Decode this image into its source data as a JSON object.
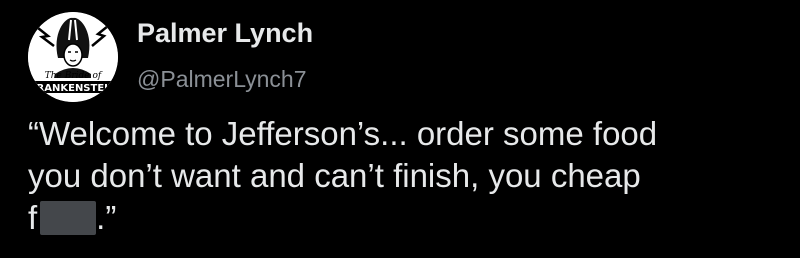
{
  "author": {
    "name": "Palmer Lynch",
    "handle": "@PalmerLynch7",
    "avatar": {
      "icon": "bride-of-frankenstein-avatar-icon",
      "title_script": "The Bride of",
      "title_block": "FRANKENSTEIN"
    }
  },
  "tweet": {
    "lines": [
      "“Welcome to Jefferson’s... order some food",
      "you don’t want and can’t finish, you cheap"
    ],
    "last_line_prefix": "f",
    "last_line_suffix": ".”",
    "redaction_color": "#44474b"
  },
  "colors": {
    "background": "#000000",
    "text": "#e7e9ea",
    "handle": "#8b9096"
  }
}
